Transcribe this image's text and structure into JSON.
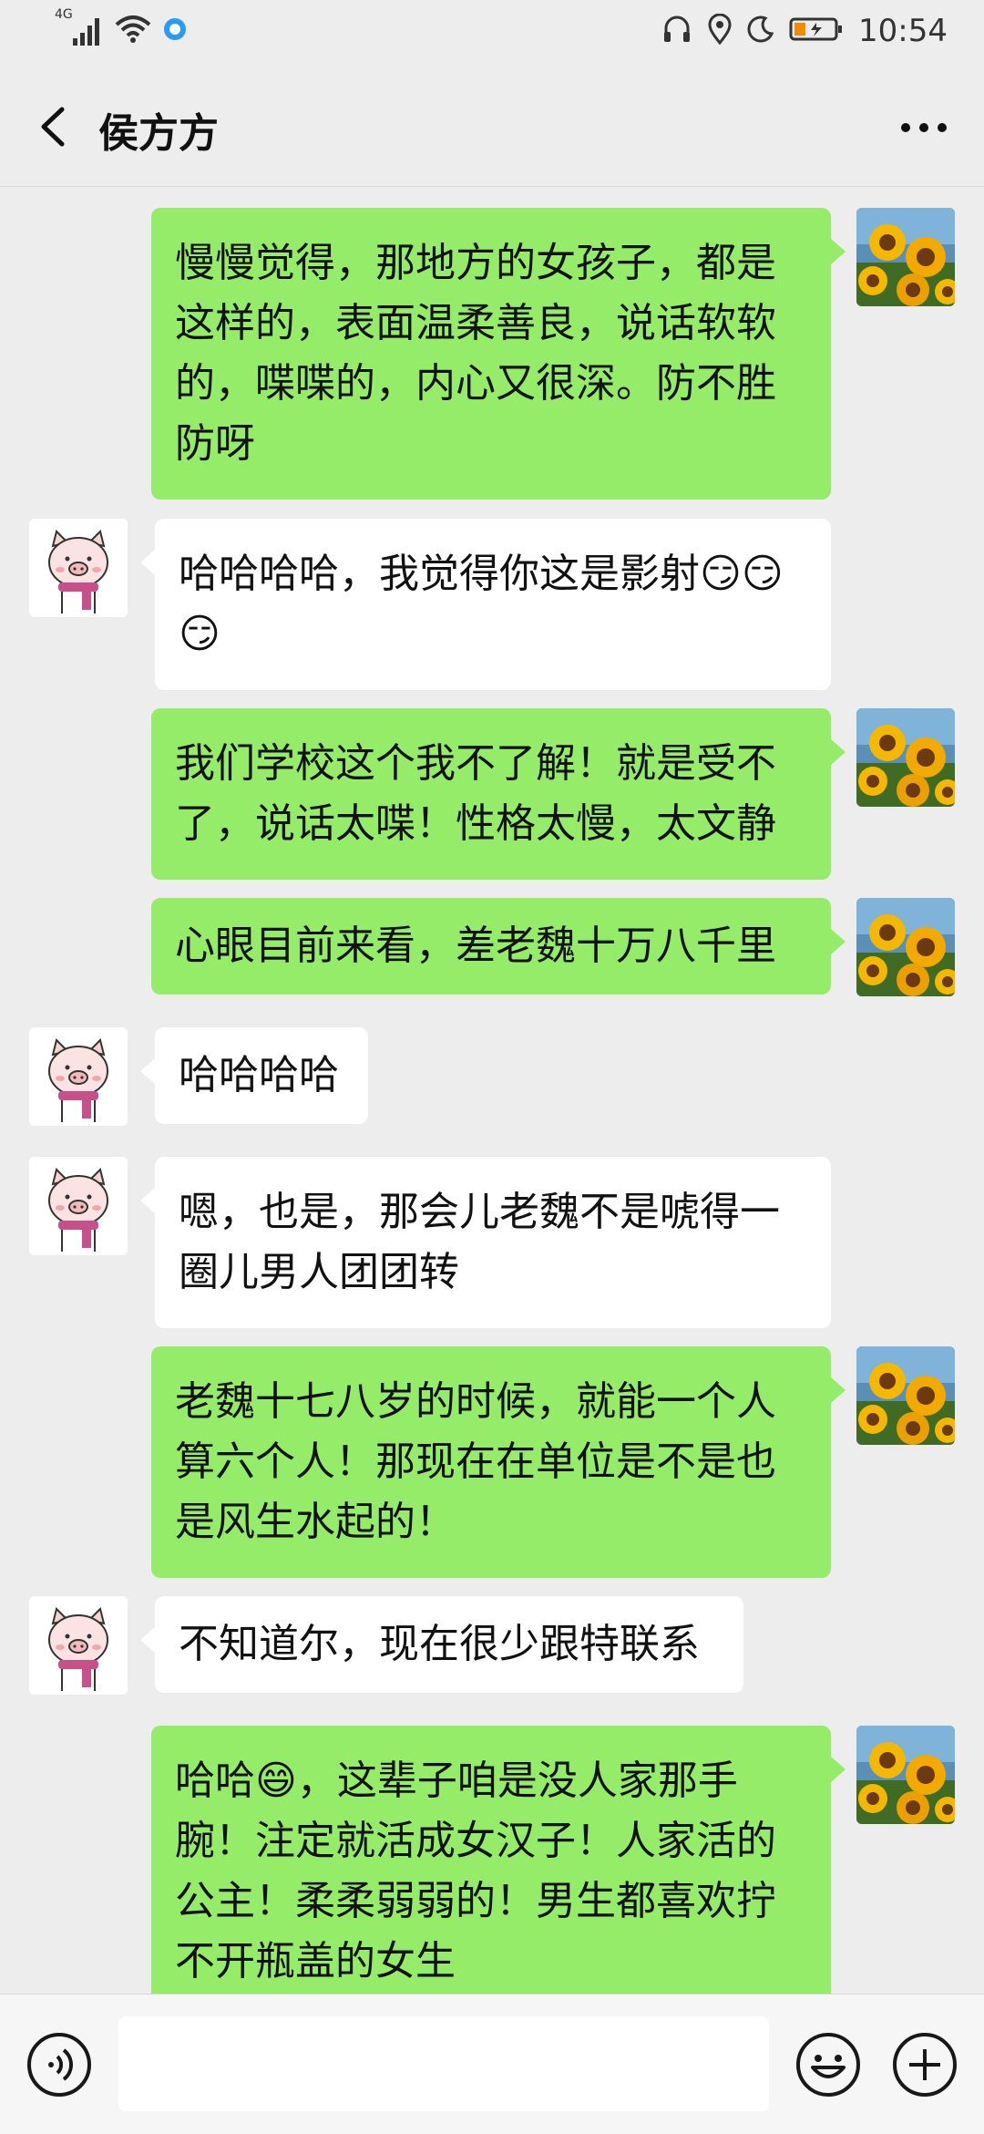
{
  "status_bar": {
    "network": "4G",
    "time": "10:54"
  },
  "header": {
    "title": "侯方方"
  },
  "colors": {
    "my_bubble": "#95ec69",
    "their_bubble": "#ffffff",
    "background": "#ededed"
  },
  "messages": [
    {
      "sender": "me",
      "text": "慢慢觉得，那地方的女孩子，都是\n这样的，表面温柔善良，说话软软\n的，喋喋的，内心又很深。防不胜\n防呀"
    },
    {
      "sender": "them",
      "text": "哈哈哈哈，我觉得你这是影射",
      "emojis": [
        "😏",
        "😏",
        "😏"
      ]
    },
    {
      "sender": "me",
      "text": "我们学校这个我不了解！就是受不\n了，说话太喋！性格太慢，太文静"
    },
    {
      "sender": "me",
      "text": "心眼目前来看，差老魏十万八千里"
    },
    {
      "sender": "them",
      "text": "哈哈哈哈"
    },
    {
      "sender": "them",
      "text": "嗯，也是，那会儿老魏不是唬得一\n圈儿男人团团转"
    },
    {
      "sender": "me",
      "text": "老魏十七八岁的时候，就能一个人\n算六个人！那现在在单位是不是也\n是风生水起的！"
    },
    {
      "sender": "them",
      "text": "不知道尔，现在很少跟特联系"
    },
    {
      "sender": "me",
      "text_before": "哈哈",
      "emoji": "😄",
      "text_after": "，这辈子咱是没人家那手\n腕！注定就活成女汉子！人家活的\n公主！柔柔弱弱的！男生都喜欢拧\n不开瓶盖的女生"
    }
  ],
  "icons": {
    "back": "chevron-left-icon",
    "more": "more-dots-icon",
    "voice": "voice-icon",
    "emoji": "emoji-icon",
    "plus": "plus-icon"
  }
}
